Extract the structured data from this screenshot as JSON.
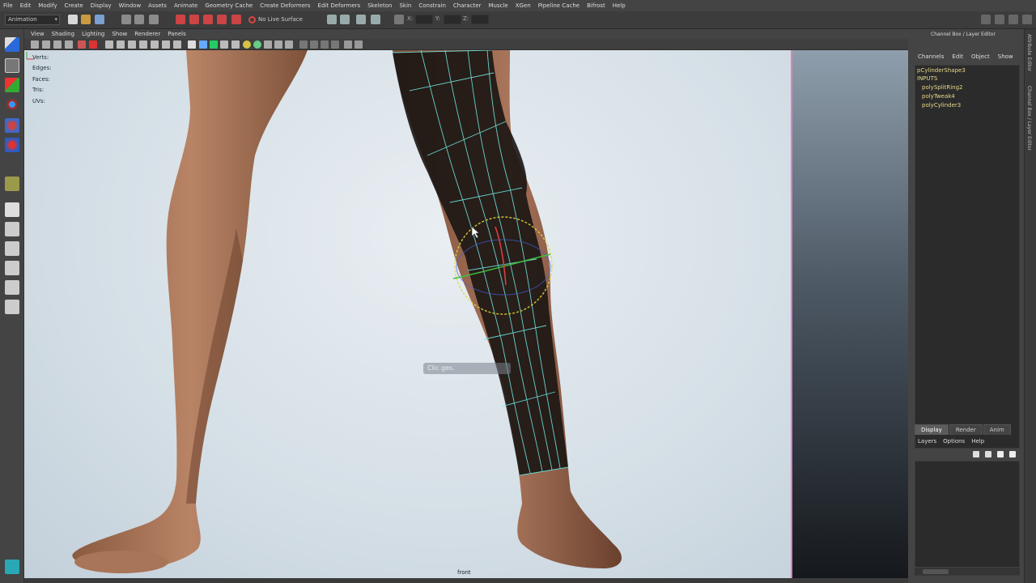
{
  "menubar": {
    "items": [
      "File",
      "Edit",
      "Modify",
      "Create",
      "Display",
      "Window",
      "Assets",
      "Animate",
      "Geometry Cache",
      "Create Deformers",
      "Edit Deformers",
      "Skeleton",
      "Skin",
      "Constrain",
      "Character",
      "Muscle",
      "XGen",
      "Pipeline Cache",
      "Bifrost",
      "Help"
    ]
  },
  "statusline": {
    "mode": "Animation",
    "live_surface": "No Live Surface",
    "x_label": "X:",
    "y_label": "Y:",
    "z_label": "Z:"
  },
  "panel": {
    "menu": [
      "View",
      "Shading",
      "Lighting",
      "Show",
      "Renderer",
      "Panels"
    ]
  },
  "hud": {
    "verts_label": "Verts:",
    "edges_label": "Edges:",
    "faces_label": "Faces:",
    "tris_label": "Tris:",
    "uvs_label": "UVs:"
  },
  "viewport": {
    "camera_label": "front",
    "hint_text": "Clic    ges."
  },
  "channel_box": {
    "title": "Channel Box / Layer Editor",
    "menu": [
      "Channels",
      "Edit",
      "Object",
      "Show"
    ],
    "node": "pCylinderShape3",
    "inputs_heading": "INPUTS",
    "inputs": [
      "polySplitRing2",
      "polyTweak4",
      "polyCylinder3"
    ]
  },
  "right_strip": {
    "tabs": [
      "Attribute Editor",
      "Channel Box / Layer Editor"
    ]
  },
  "layer_editor": {
    "tabs": [
      "Display",
      "Render",
      "Anim"
    ],
    "menu": [
      "Layers",
      "Options",
      "Help"
    ]
  },
  "colors": {
    "selection_highlight": "#e27fbf",
    "wireframe": "#6fe6e0",
    "manipulator_ring": "#e0d83a"
  }
}
